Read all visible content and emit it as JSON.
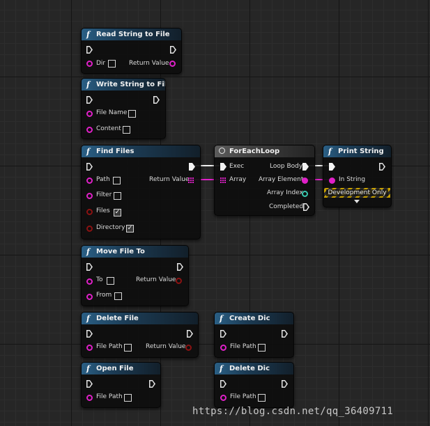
{
  "nodes": {
    "read_string_to_file": {
      "title": "Read String to File",
      "pins": {
        "dir": "Dir",
        "return_value": "Return Value"
      }
    },
    "write_string_to_file": {
      "title": "Write String to File",
      "pins": {
        "file_name": "File Name",
        "content": "Content"
      }
    },
    "find_files": {
      "title": "Find Files",
      "pins": {
        "path": "Path",
        "filter": "Filter",
        "files": "Files",
        "directory": "Directory",
        "return_value": "Return Value"
      },
      "files_checked": true,
      "directory_checked": true
    },
    "for_each_loop": {
      "title": "ForEachLoop",
      "pins": {
        "exec": "Exec",
        "array": "Array",
        "loop_body": "Loop Body",
        "array_element": "Array Element",
        "array_index": "Array Index",
        "completed": "Completed"
      }
    },
    "print_string": {
      "title": "Print String",
      "pins": {
        "in_string": "In String"
      },
      "dev_only": "Development Only"
    },
    "move_file_to": {
      "title": "Move File To",
      "pins": {
        "to": "To",
        "from": "From",
        "return_value": "Return Value"
      }
    },
    "delete_file": {
      "title": "Delete File",
      "pins": {
        "file_path": "File Path",
        "return_value": "Return Value"
      }
    },
    "create_dic": {
      "title": "Create Dic",
      "pins": {
        "file_path": "File Path"
      }
    },
    "open_file": {
      "title": "Open File",
      "pins": {
        "file_path": "File Path"
      }
    },
    "delete_dic": {
      "title": "Delete Dic",
      "pins": {
        "file_path": "File Path"
      }
    }
  },
  "icons": {
    "function": "f",
    "checkmark": "✓",
    "checkbox_checked": "checked"
  },
  "colors": {
    "exec_wire": "#ffffff",
    "string_pin": "#e020c8",
    "bool_pin": "#8b1212",
    "int_pin": "#39c9b0",
    "function_header": "#2a5f85"
  },
  "watermark": "https://blog.csdn.net/qq_36409711"
}
